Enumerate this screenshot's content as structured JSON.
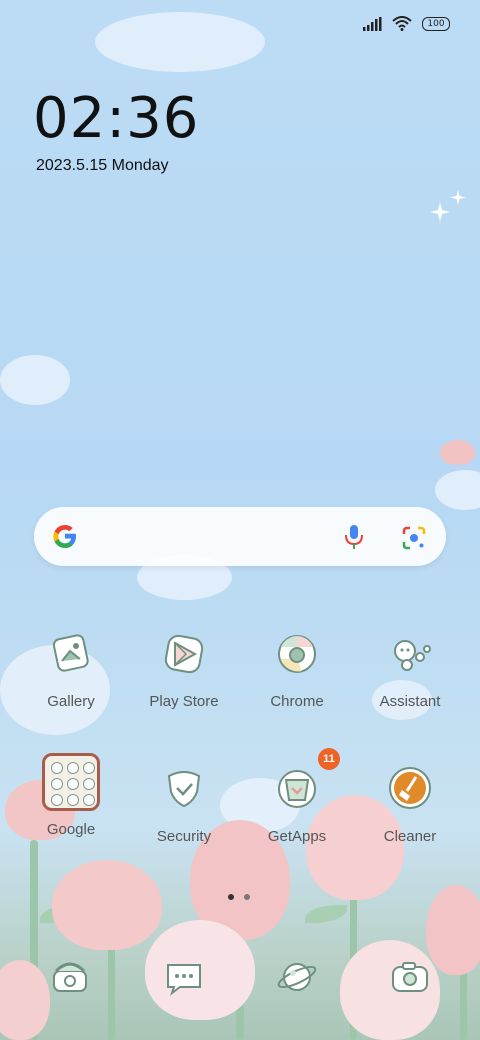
{
  "status_bar": {
    "battery": "100",
    "icons": [
      "signal-icon",
      "wifi-icon",
      "battery-icon"
    ]
  },
  "clock": {
    "time": "02:36",
    "date": "2023.5.15 Monday"
  },
  "search": {
    "icons": [
      "google-logo-icon",
      "mic-icon",
      "lens-icon"
    ]
  },
  "apps": [
    {
      "label": "Gallery",
      "icon": "gallery-icon"
    },
    {
      "label": "Play Store",
      "icon": "play-store-icon"
    },
    {
      "label": "Chrome",
      "icon": "chrome-icon"
    },
    {
      "label": "Assistant",
      "icon": "assistant-icon"
    },
    {
      "label": "Google",
      "icon": "google-folder-icon"
    },
    {
      "label": "Security",
      "icon": "security-icon"
    },
    {
      "label": "GetApps",
      "icon": "getapps-icon",
      "badge": "11"
    },
    {
      "label": "Cleaner",
      "icon": "cleaner-icon"
    }
  ],
  "pager": {
    "pages": 2,
    "current": 1
  },
  "dock": [
    "phone-icon",
    "messages-icon",
    "browser-icon",
    "camera-icon"
  ],
  "colors": {
    "icon_stroke": "#6f8f80",
    "badge": "#f06326",
    "cleaner": "#e08a2a"
  }
}
